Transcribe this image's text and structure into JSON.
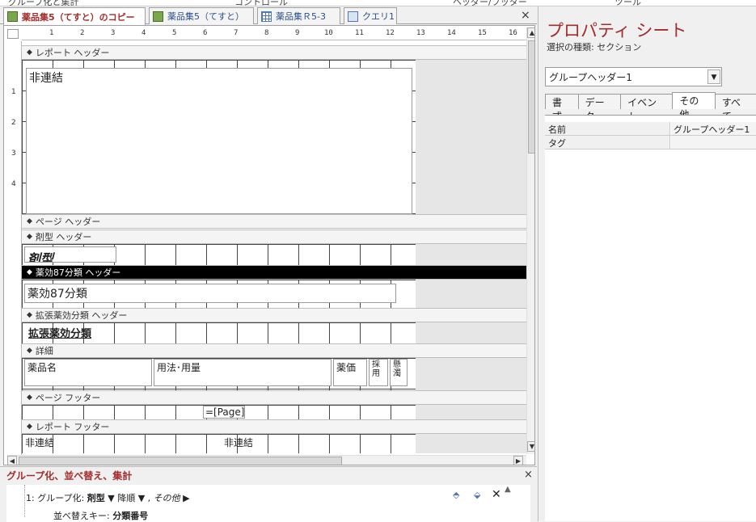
{
  "ribbon": {
    "fragments": [
      "グループ化と集計",
      "コントロール",
      "ヘッダー/フッター",
      "ツール"
    ]
  },
  "tabs": [
    {
      "label": "薬品集5（てすと）のコピー",
      "icon": "report-icon",
      "active": true
    },
    {
      "label": "薬品集5（てすと）",
      "icon": "report-icon",
      "active": false
    },
    {
      "label": "薬品集Ｒ5-3",
      "icon": "table-icon",
      "active": false
    },
    {
      "label": "クエリ1",
      "icon": "query-icon",
      "active": false
    }
  ],
  "close_glyph": "×",
  "ruler": {
    "marks": [
      "1",
      "2",
      "3",
      "4",
      "5",
      "6",
      "7",
      "8",
      "9",
      "10",
      "11",
      "12",
      "13",
      "14",
      "15",
      "16"
    ]
  },
  "sections": {
    "report_header": {
      "label": "レポート ヘッダー",
      "control": "非連結"
    },
    "page_header": {
      "label": "ページ ヘッダー"
    },
    "group_kei": {
      "label": "剤型 ヘッダー",
      "control": "剤型"
    },
    "group_yakko": {
      "label": "薬効87分類 ヘッダー",
      "control": "薬効87分類"
    },
    "group_kakucho": {
      "label": "拡張薬効分類 ヘッダー",
      "control": "拡張薬効分類"
    },
    "detail": {
      "label": "詳細",
      "controls": [
        "薬品名",
        "用法･用量",
        "薬価",
        "採用",
        "懸濁"
      ]
    },
    "page_footer": {
      "label": "ページ フッター",
      "control": "=[Page]"
    },
    "report_footer": {
      "label": "レポート フッター",
      "controls": [
        "非連結",
        "非連結"
      ]
    }
  },
  "group_sort": {
    "title": "グループ化、並べ替え、集計",
    "row1": {
      "prefix": "1: グループ化:",
      "field": "剤型",
      "order": "降順",
      "more": "その他 ▶"
    },
    "row2": {
      "prefix": "並べ替えキー:",
      "field": "分類番号"
    }
  },
  "property_sheet": {
    "title": "プロパティ シート",
    "selection_type": "選択の種類: セクション",
    "selected_object": "グループヘッダー1",
    "tabs": [
      "書式",
      "データ",
      "イベント",
      "その他",
      "すべて"
    ],
    "active_tab": "その他",
    "rows": [
      {
        "key": "名前",
        "value": "グループヘッダー1"
      },
      {
        "key": "タグ",
        "value": ""
      }
    ]
  },
  "colors": {
    "accent": "#a32c2c",
    "selected_section": "#000000"
  }
}
